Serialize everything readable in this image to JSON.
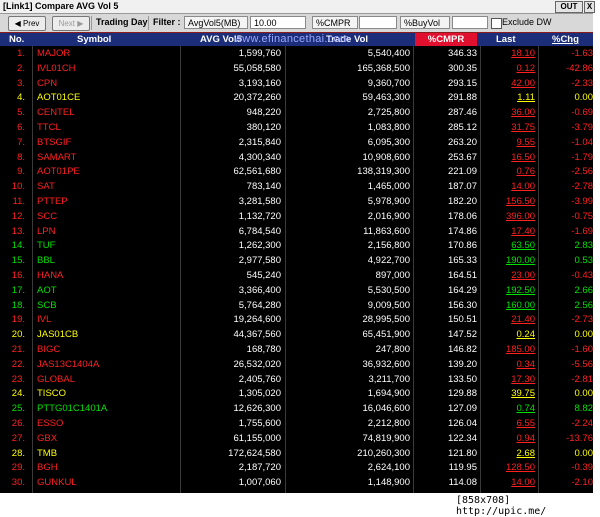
{
  "window": {
    "title": "[Link1] Compare AVG Vol 5",
    "out_label": "OUT",
    "close_label": "X"
  },
  "toolbar": {
    "prev_label": "Prev",
    "next_label": "Next",
    "trading_day": "Trading Day",
    "filter_label": "Filter :",
    "avgvol_combo": "AvgVol5(MB) >=",
    "avgvol_value": "10.00",
    "cmpr_combo": "%CMPR >=",
    "cmpr_value": "",
    "buyvol_combo": "%BuyVol >=",
    "buyvol_value": "",
    "exclude_dw": "Exclude DW"
  },
  "watermark": "www.efinancethai.com",
  "headers": {
    "no": "No.",
    "symbol": "Symbol",
    "avg": "AVG Vol5",
    "tv": "Trade Vol",
    "cmpr": "%CMPR",
    "last": "Last",
    "chg": "%Chg"
  },
  "colors": {
    "up": "#00e000",
    "down": "#ff2020",
    "flat": "#ffff00",
    "header_bg": "#1c2d7a",
    "cmpr_header": "#e0102e"
  },
  "rows": [
    {
      "no": "1.",
      "symbol": "MAJOR",
      "avg": "1,599,760",
      "tv": "5,540,400",
      "cmpr": "346.33",
      "last": "18.10",
      "chg": "-1.63",
      "dir": "down"
    },
    {
      "no": "2.",
      "symbol": "IVL01CH",
      "avg": "55,058,580",
      "tv": "165,368,500",
      "cmpr": "300.35",
      "last": "0.12",
      "chg": "-42.86",
      "dir": "down"
    },
    {
      "no": "3.",
      "symbol": "CPN",
      "avg": "3,193,160",
      "tv": "9,360,700",
      "cmpr": "293.15",
      "last": "42.00",
      "chg": "-2.33",
      "dir": "down"
    },
    {
      "no": "4.",
      "symbol": "AOT01CE",
      "avg": "20,372,260",
      "tv": "59,463,300",
      "cmpr": "291.88",
      "last": "1.11",
      "chg": "0.00",
      "dir": "flat"
    },
    {
      "no": "5.",
      "symbol": "CENTEL",
      "avg": "948,220",
      "tv": "2,725,800",
      "cmpr": "287.46",
      "last": "36.00",
      "chg": "-0.69",
      "dir": "down"
    },
    {
      "no": "6.",
      "symbol": "TTCL",
      "avg": "380,120",
      "tv": "1,083,800",
      "cmpr": "285.12",
      "last": "31.75",
      "chg": "-3.79",
      "dir": "down"
    },
    {
      "no": "7.",
      "symbol": "BTSGIF",
      "avg": "2,315,840",
      "tv": "6,095,300",
      "cmpr": "263.20",
      "last": "9.55",
      "chg": "-1.04",
      "dir": "down"
    },
    {
      "no": "8.",
      "symbol": "SAMART",
      "avg": "4,300,340",
      "tv": "10,908,600",
      "cmpr": "253.67",
      "last": "16.50",
      "chg": "-1.79",
      "dir": "down"
    },
    {
      "no": "9.",
      "symbol": "AOT01PE",
      "avg": "62,561,680",
      "tv": "138,319,300",
      "cmpr": "221.09",
      "last": "0.76",
      "chg": "-2.56",
      "dir": "down"
    },
    {
      "no": "10.",
      "symbol": "SAT",
      "avg": "783,140",
      "tv": "1,465,000",
      "cmpr": "187.07",
      "last": "14.00",
      "chg": "-2.78",
      "dir": "down"
    },
    {
      "no": "11.",
      "symbol": "PTTEP",
      "avg": "3,281,580",
      "tv": "5,978,900",
      "cmpr": "182.20",
      "last": "156.50",
      "chg": "-3.99",
      "dir": "down"
    },
    {
      "no": "12.",
      "symbol": "SCC",
      "avg": "1,132,720",
      "tv": "2,016,900",
      "cmpr": "178.06",
      "last": "396.00",
      "chg": "-0.75",
      "dir": "down"
    },
    {
      "no": "13.",
      "symbol": "LPN",
      "avg": "6,784,540",
      "tv": "11,863,600",
      "cmpr": "174.86",
      "last": "17.40",
      "chg": "-1.69",
      "dir": "down"
    },
    {
      "no": "14.",
      "symbol": "TUF",
      "avg": "1,262,300",
      "tv": "2,156,800",
      "cmpr": "170.86",
      "last": "63.50",
      "chg": "2.83",
      "dir": "up"
    },
    {
      "no": "15.",
      "symbol": "BBL",
      "avg": "2,977,580",
      "tv": "4,922,700",
      "cmpr": "165.33",
      "last": "190.00",
      "chg": "0.53",
      "dir": "up"
    },
    {
      "no": "16.",
      "symbol": "HANA",
      "avg": "545,240",
      "tv": "897,000",
      "cmpr": "164.51",
      "last": "23.00",
      "chg": "-0.43",
      "dir": "down"
    },
    {
      "no": "17.",
      "symbol": "AOT",
      "avg": "3,366,400",
      "tv": "5,530,500",
      "cmpr": "164.29",
      "last": "192.50",
      "chg": "2.66",
      "dir": "up"
    },
    {
      "no": "18.",
      "symbol": "SCB",
      "avg": "5,764,280",
      "tv": "9,009,500",
      "cmpr": "156.30",
      "last": "160.00",
      "chg": "2.56",
      "dir": "up"
    },
    {
      "no": "19.",
      "symbol": "IVL",
      "avg": "19,264,600",
      "tv": "28,995,500",
      "cmpr": "150.51",
      "last": "21.40",
      "chg": "-2.73",
      "dir": "down"
    },
    {
      "no": "20.",
      "symbol": "JAS01CB",
      "avg": "44,367,560",
      "tv": "65,451,900",
      "cmpr": "147.52",
      "last": "0.24",
      "chg": "0.00",
      "dir": "flat"
    },
    {
      "no": "21.",
      "symbol": "BIGC",
      "avg": "168,780",
      "tv": "247,800",
      "cmpr": "146.82",
      "last": "185.00",
      "chg": "-1.60",
      "dir": "down"
    },
    {
      "no": "22.",
      "symbol": "JAS13C1404A",
      "avg": "26,532,020",
      "tv": "36,932,600",
      "cmpr": "139.20",
      "last": "0.34",
      "chg": "-5.56",
      "dir": "down"
    },
    {
      "no": "23.",
      "symbol": "GLOBAL",
      "avg": "2,405,760",
      "tv": "3,211,700",
      "cmpr": "133.50",
      "last": "17.30",
      "chg": "-2.81",
      "dir": "down"
    },
    {
      "no": "24.",
      "symbol": "TISCO",
      "avg": "1,305,020",
      "tv": "1,694,900",
      "cmpr": "129.88",
      "last": "39.75",
      "chg": "0.00",
      "dir": "flat"
    },
    {
      "no": "25.",
      "symbol": "PTTG01C1401A",
      "avg": "12,626,300",
      "tv": "16,046,600",
      "cmpr": "127.09",
      "last": "0.74",
      "chg": "8.82",
      "dir": "up"
    },
    {
      "no": "26.",
      "symbol": "ESSO",
      "avg": "1,755,600",
      "tv": "2,212,800",
      "cmpr": "126.04",
      "last": "6.55",
      "chg": "-2.24",
      "dir": "down"
    },
    {
      "no": "27.",
      "symbol": "GBX",
      "avg": "61,155,000",
      "tv": "74,819,900",
      "cmpr": "122.34",
      "last": "0.94",
      "chg": "-13.76",
      "dir": "down"
    },
    {
      "no": "28.",
      "symbol": "TMB",
      "avg": "172,624,580",
      "tv": "210,260,300",
      "cmpr": "121.80",
      "last": "2.68",
      "chg": "0.00",
      "dir": "flat"
    },
    {
      "no": "29.",
      "symbol": "BGH",
      "avg": "2,187,720",
      "tv": "2,624,100",
      "cmpr": "119.95",
      "last": "128.50",
      "chg": "-0.39",
      "dir": "down"
    },
    {
      "no": "30.",
      "symbol": "GUNKUL",
      "avg": "1,007,060",
      "tv": "1,148,900",
      "cmpr": "114.08",
      "last": "14.00",
      "chg": "-2.10",
      "dir": "down"
    }
  ],
  "footer": "[858x708] http://upic.me/"
}
